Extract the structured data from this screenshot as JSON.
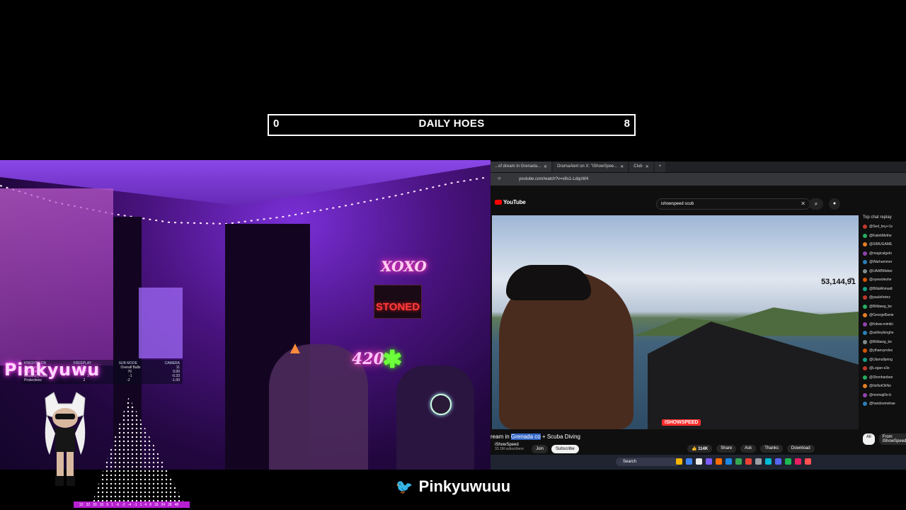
{
  "goal": {
    "left_value": "0",
    "title": "DAILY HOES",
    "right_value": "8"
  },
  "overlay": {
    "name_logo": "Pinkyuwu",
    "stats_header": [
      "KNIGHTS ON",
      "FREEPLAY",
      "SUB MODE",
      "CAMERA"
    ],
    "stats_rows": [
      [
        "Session Balls",
        "12",
        "Overall Balls",
        "11"
      ],
      [
        "NightFlexE3",
        "7",
        "76",
        "0.00"
      ],
      [
        "Mozartz_Aceal",
        "3",
        "-1",
        "-0.33"
      ],
      [
        "Protectives",
        "2",
        "-2",
        "-1.00"
      ]
    ],
    "ticker": [
      "12",
      "32",
      "30",
      "10",
      "9",
      "1",
      "-6",
      "-2",
      "-4",
      "-1",
      "1",
      "4",
      "8",
      "16",
      "24",
      "28",
      "48"
    ]
  },
  "browser": {
    "tabs": [
      {
        "label": "...of dream in Grenada...",
        "active": true
      },
      {
        "label": "DramaAlert on X: \"iShowSpee...",
        "active": false
      },
      {
        "label": "Club",
        "active": false
      }
    ],
    "url": "youtube.com/watch?v=x8s1-LdqsW4",
    "logo": "YouTube",
    "search_value": "ishowspeed scub",
    "video": {
      "viewer_counter": "53,144,9̅̆1",
      "watermark": "ISHOWSPEED",
      "title_before": "ream in ",
      "title_highlight": "Grenada co",
      "title_after": " + Scuba Diving",
      "channel": "iShowSpeed",
      "subs": "33.1M subscribers",
      "join": "Join",
      "subscribe": "Subscribe",
      "likes": "114K",
      "share": "Share",
      "ask": "Ask",
      "thanks": "Thanks",
      "download": "Download"
    },
    "chat": {
      "header": "Top chat replay",
      "users": [
        "@Sed_boy+1x",
        "@KalebMethe",
        "@SIMUGAME",
        "@magicalgeto",
        "@Warhammer",
        "@UAABMafan",
        "@oyewoleshe",
        "@BillalAhmadi",
        "@paulofortez",
        "@Billdawg_be",
        "@GeorgeBanie",
        "@Kdww.mimiki",
        "@ashleybinghe",
        "@Billdawg_be",
        "@ythanvyrelex",
        "@Ulamullpring",
        "@Logan-s3e",
        "@Shenhanbee",
        "@ItsNotOkNo",
        "@momaji0e-b",
        "@handsomehae"
      ],
      "tab_all": "All",
      "tab_from": "From iShowSpeed"
    },
    "taskbar_search": "Search"
  },
  "footer": {
    "handle": "Pinkyuwuuu"
  },
  "colors": {
    "accent_purple": "#b71fd1",
    "twitter_blue": "#1da1f2",
    "youtube_red": "#ff0000"
  }
}
